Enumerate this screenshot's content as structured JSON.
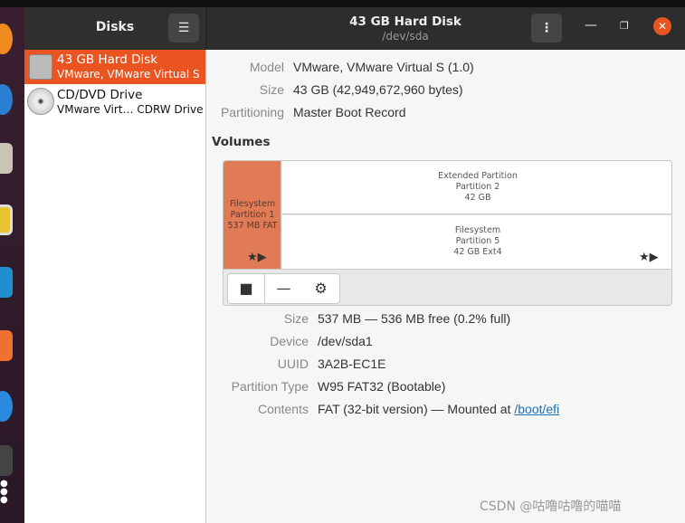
{
  "sidebar": {
    "title": "Disks",
    "disks": [
      {
        "name": "43 GB Hard Disk",
        "sub": "VMware, VMware Virtual S"
      },
      {
        "name": "CD/DVD Drive",
        "sub": "VMware Virt… CDRW Drive"
      }
    ]
  },
  "header": {
    "title": "43 GB Hard Disk",
    "subtitle": "/dev/sda"
  },
  "disk_info": [
    {
      "label": "Model",
      "value": "VMware, VMware Virtual S (1.0)"
    },
    {
      "label": "Size",
      "value": "43 GB (42,949,672,960 bytes)"
    },
    {
      "label": "Partitioning",
      "value": "Master Boot Record"
    }
  ],
  "volumes_title": "Volumes",
  "partitions": {
    "p1": [
      "Filesystem",
      "Partition 1",
      "537 MB FAT"
    ],
    "p2": [
      "Extended Partition",
      "Partition 2",
      "42 GB"
    ],
    "p5": [
      "Filesystem",
      "Partition 5",
      "42 GB Ext4"
    ]
  },
  "details": [
    {
      "label": "Size",
      "value": "537 MB — 536 MB free (0.2% full)"
    },
    {
      "label": "Device",
      "value": "/dev/sda1"
    },
    {
      "label": "UUID",
      "value": "3A2B-EC1E"
    },
    {
      "label": "Partition Type",
      "value": "W95 FAT32 (Bootable)"
    }
  ],
  "contents": {
    "label": "Contents",
    "prefix": "FAT (32-bit version) — Mounted at ",
    "link": "/boot/efi"
  },
  "watermark": "CSDN @咕噜咕噜的喵喵",
  "colors": {
    "accent": "#e95420",
    "partition_selected": "#e07b55",
    "link": "#1a73b8"
  }
}
